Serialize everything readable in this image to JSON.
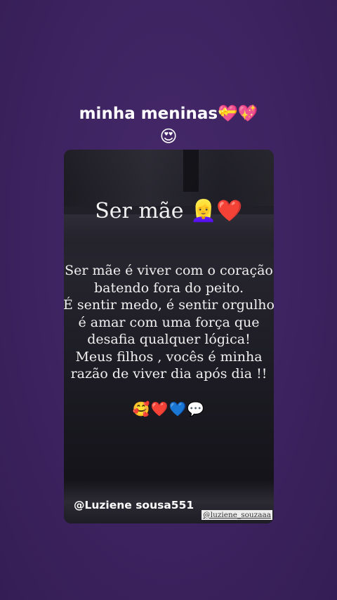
{
  "caption": {
    "line1": "minha meninas💝💖",
    "line2": "😍"
  },
  "card": {
    "title": "Ser mãe 👱‍♀️❤️",
    "body": "Ser mãe é viver com o coração\nbatendo fora do peito.\nÉ sentir medo, é sentir orgulho\né amar com uma força que\ndesafia qualquer lógica!\nMeus filhos , vocês é minha\nrazão de viver dia após dia !!",
    "emojis": "🥰❤️💙💬",
    "author": "@Luziene sousa551",
    "watermark": "@luziene_souzaaa"
  },
  "colors": {
    "background": "#3f2562",
    "card_background": "#1e1d25",
    "text": "#ffffff"
  }
}
